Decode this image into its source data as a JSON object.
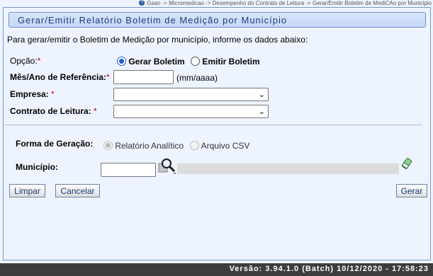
{
  "breadcrumb": "Gsan -> Micromedicao -> Desempenho do Contrato de Leitura -> Gerar/Emitir Boletim de MediCAo por Municipio",
  "title": "Gerar/Emitir Relatório Boletim de Medição por Município",
  "intro": "Para gerar/emitir o Boletim de Medição por município, informe os dados abaixo:",
  "opcao": {
    "label": "Opção:",
    "required": "*",
    "options": [
      "Gerar Boletim",
      "Emitir Boletim"
    ],
    "selected": "Gerar Boletim"
  },
  "mes_ano": {
    "label": "Mês/Ano de Referência:",
    "required": "*",
    "value": "",
    "hint": "(mm/aaaa)"
  },
  "empresa": {
    "label": "Empresa:",
    "required": "*",
    "value": ""
  },
  "contrato": {
    "label": "Contrato de Leitura:",
    "required": "*",
    "value": ""
  },
  "forma_geracao": {
    "label": "Forma de Geração:",
    "options": [
      "Relatório Analítico",
      "Arquivo CSV"
    ],
    "selected": "Relatório Analítico",
    "disabled": true
  },
  "municipio": {
    "label": "Município:",
    "code": "",
    "name": ""
  },
  "buttons": {
    "limpar": "Limpar",
    "cancelar": "Cancelar",
    "gerar": "Gerar"
  },
  "footer": "Versão: 3.94.1.0 (Batch) 10/12/2020 - 17:58:23",
  "icons": [
    "help-icon",
    "search-magnifier-icon",
    "eraser-icon",
    "chevron-down-icon"
  ],
  "colors": {
    "title_text": "#1b3b7a",
    "required": "#cc0000",
    "footer_bg": "#3d3d3d",
    "radio_on": "#1f5fcc"
  }
}
